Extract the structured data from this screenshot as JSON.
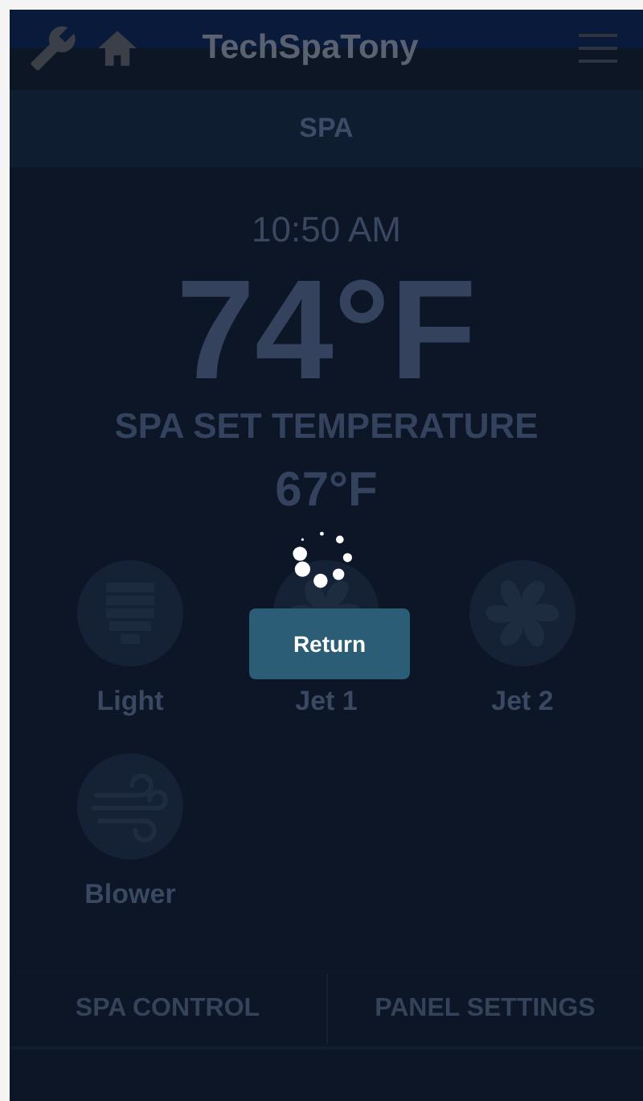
{
  "header": {
    "title": "TechSpaTony"
  },
  "section_tab": {
    "label": "SPA"
  },
  "time": "10:50 AM",
  "current_temperature": "74°F",
  "set_temperature_label": "SPA SET TEMPERATURE",
  "set_temperature": "67°F",
  "controls": [
    {
      "kind": "light",
      "label": "Light"
    },
    {
      "kind": "jet",
      "label": "Jet 1"
    },
    {
      "kind": "jet",
      "label": "Jet 2"
    },
    {
      "kind": "blower",
      "label": "Blower"
    }
  ],
  "bottom_tabs": [
    {
      "label": "SPA CONTROL"
    },
    {
      "label": "PANEL SETTINGS"
    }
  ],
  "loading_dialog": {
    "button": "Return"
  }
}
